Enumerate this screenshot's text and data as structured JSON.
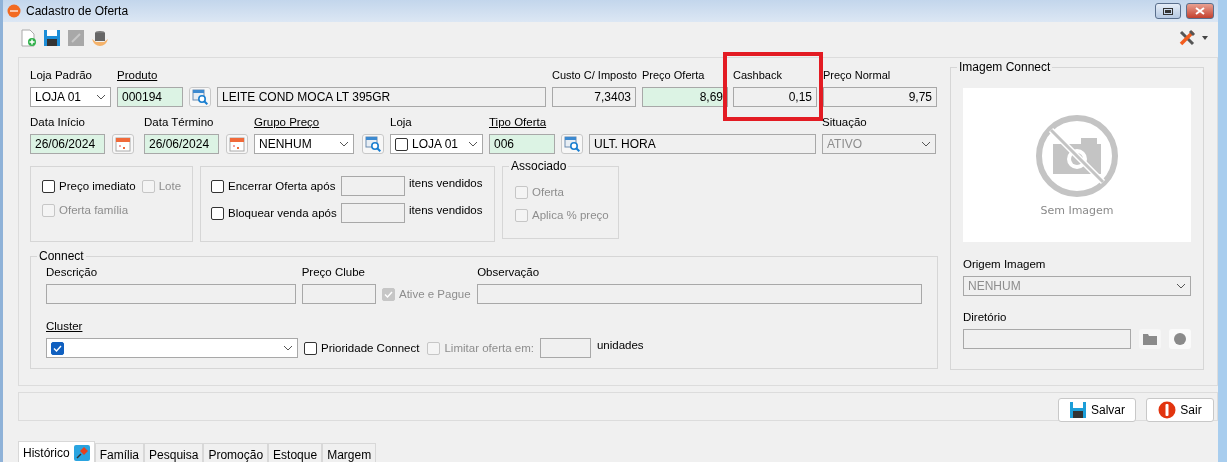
{
  "window": {
    "title": "Cadastro de Oferta"
  },
  "loja_padrao": {
    "label": "Loja Padrão",
    "value": "LOJA 01"
  },
  "produto": {
    "label": "Produto",
    "link": true,
    "code": "000194",
    "description": "LEITE COND MOCA LT 395GR"
  },
  "prices": [
    {
      "label": "Custo C/ Imposto",
      "value": "7,3403",
      "editable": false,
      "highlighted": false
    },
    {
      "label": "Preço Oferta",
      "value": "8,69",
      "editable": true,
      "highlighted": false
    },
    {
      "label": "Cashback",
      "value": "0,15",
      "editable": false,
      "highlighted": true
    },
    {
      "label": "Preço Normal",
      "value": "9,75",
      "editable": false,
      "highlighted": false
    }
  ],
  "data_inicio": {
    "label": "Data Início",
    "value": "26/06/2024"
  },
  "data_termino": {
    "label": "Data Término",
    "value": "26/06/2024"
  },
  "grupo_preco": {
    "label": "Grupo Preço",
    "link": true,
    "value": "NENHUM"
  },
  "loja": {
    "label": "Loja",
    "value": "LOJA 01",
    "checked": false
  },
  "tipo_oferta": {
    "label": "Tipo Oferta",
    "link": true,
    "code": "006",
    "description": "ULT. HORA"
  },
  "situacao": {
    "label": "Situação",
    "value": "ATIVO",
    "disabled": true
  },
  "options": [
    {
      "label": "Preço imediato",
      "checked": false,
      "disabled": false
    },
    {
      "label": "Lote",
      "checked": false,
      "disabled": true
    },
    {
      "label": "Oferta família",
      "checked": false,
      "disabled": true
    }
  ],
  "limits": [
    {
      "label": "Encerrar Oferta após",
      "checked": false,
      "suffix": "itens vendidos"
    },
    {
      "label": "Bloquear venda após",
      "checked": false,
      "suffix": "itens vendidos"
    }
  ],
  "associado": {
    "title": "Associado",
    "options": [
      {
        "label": "Oferta",
        "checked": false,
        "disabled": true
      },
      {
        "label": "Aplica % preço",
        "checked": false,
        "disabled": true
      }
    ]
  },
  "connect": {
    "title": "Connect",
    "descricao_label": "Descrição",
    "preco_clube_label": "Preço Clube",
    "ative_e_pague": {
      "label": "Ative e Pague",
      "checked": true,
      "disabled": true
    },
    "observacao_label": "Observação",
    "cluster": {
      "label": "Cluster",
      "link": true,
      "checked": true
    },
    "prioridade": {
      "label": "Prioridade Connect",
      "checked": false,
      "disabled": false
    },
    "limitar": {
      "label": "Limitar oferta em:",
      "checked": false,
      "disabled": true
    },
    "unit": "unidades"
  },
  "imagem": {
    "title": "Imagem Connect",
    "empty_text": "Sem Imagem",
    "origem_label": "Origem Imagem",
    "origem_value": "NENHUM",
    "diretorio_label": "Diretório"
  },
  "buttons": [
    {
      "label": "Salvar",
      "kind": "save"
    },
    {
      "label": "Sair",
      "kind": "exit"
    }
  ],
  "tabs": [
    {
      "label": "Histórico",
      "selected": true,
      "pinned": true
    },
    {
      "label": "Família",
      "selected": false,
      "pinned": false
    },
    {
      "label": "Pesquisa",
      "selected": false,
      "pinned": false
    },
    {
      "label": "Promoção",
      "selected": false,
      "pinned": false
    },
    {
      "label": "Estoque",
      "selected": false,
      "pinned": false
    },
    {
      "label": "Margem",
      "selected": false,
      "pinned": false
    }
  ]
}
